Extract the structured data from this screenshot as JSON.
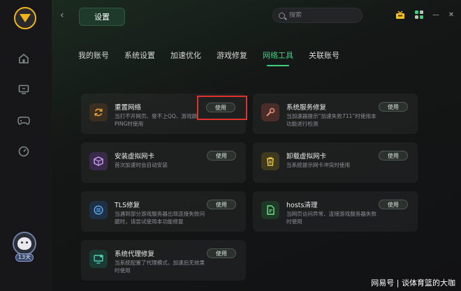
{
  "header": {
    "back_glyph": "‹",
    "active_page": "设置",
    "search_placeholder": "搜索",
    "minimize_glyph": "—",
    "close_glyph": "✕"
  },
  "sidebar": {
    "items": [
      {
        "icon": "home-icon"
      },
      {
        "icon": "monitor-icon"
      },
      {
        "icon": "gamepad-icon"
      },
      {
        "icon": "speed-icon"
      }
    ],
    "badge": "13天"
  },
  "tabs": [
    {
      "label": "我的账号",
      "active": false
    },
    {
      "label": "系统设置",
      "active": false
    },
    {
      "label": "加速优化",
      "active": false
    },
    {
      "label": "游戏修复",
      "active": false
    },
    {
      "label": "网络工具",
      "active": true
    },
    {
      "label": "关联账号",
      "active": false
    }
  ],
  "use_label": "使用",
  "tools": [
    {
      "title": "重置网络",
      "desc": "当打不开网页、登不上QQ、游戏跳PING时使用",
      "icon": "refresh-icon",
      "color": "#e8a13a",
      "bg": "#3a2e20"
    },
    {
      "title": "系统服务修复",
      "desc": "当加速器提示“加速失败711”时使用本功能进行检测",
      "icon": "wrench-icon",
      "color": "#e0907a",
      "bg": "#4a2c28"
    },
    {
      "title": "安装虚拟网卡",
      "desc": "首次加速时会自动安装",
      "icon": "cube-icon",
      "color": "#c89af0",
      "bg": "#3a2a4a"
    },
    {
      "title": "卸载虚拟网卡",
      "desc": "当系统提示网卡冲突时使用",
      "icon": "trash-icon",
      "color": "#e8c84a",
      "bg": "#3f3a1e"
    },
    {
      "title": "TLS修复",
      "desc": "当遇到部分游戏服务器出现连接失败问题时，请尝试使用本功能修复",
      "icon": "tls-icon",
      "color": "#5aa8f0",
      "bg": "#1e3046"
    },
    {
      "title": "hosts清理",
      "desc": "当网页访问异常、连接游戏服务器失败时使用",
      "icon": "hosts-file-icon",
      "color": "#6ee08a",
      "bg": "#1e3a26"
    },
    {
      "title": "系统代理修复",
      "desc": "当系统配置了代理模式，加速后无效果时使用",
      "icon": "proxy-monitor-icon",
      "color": "#4ed0b0",
      "bg": "#1a3a34"
    }
  ],
  "watermark": "网易号 | 谈体育篮的大咖"
}
